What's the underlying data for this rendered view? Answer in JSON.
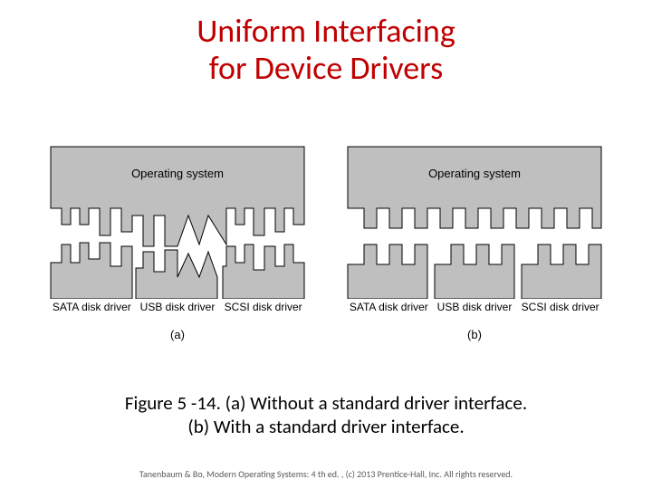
{
  "title_line1": "Uniform Interfacing",
  "title_line2": "for Device Drivers",
  "os_label": "Operating system",
  "drivers": {
    "sata": "SATA disk driver",
    "usb": "USB disk driver",
    "scsi": "SCSI disk driver"
  },
  "panel_a_label": "(a)",
  "panel_b_label": "(b)",
  "caption_line1": "Figure 5 -14. (a) Without a standard driver interface.",
  "caption_line2": "(b) With a standard driver interface.",
  "credit": "Tanenbaum & Bo, Modern  Operating Systems: 4 th ed. , (c) 2013 Prentice-Hall, Inc. All rights reserved."
}
